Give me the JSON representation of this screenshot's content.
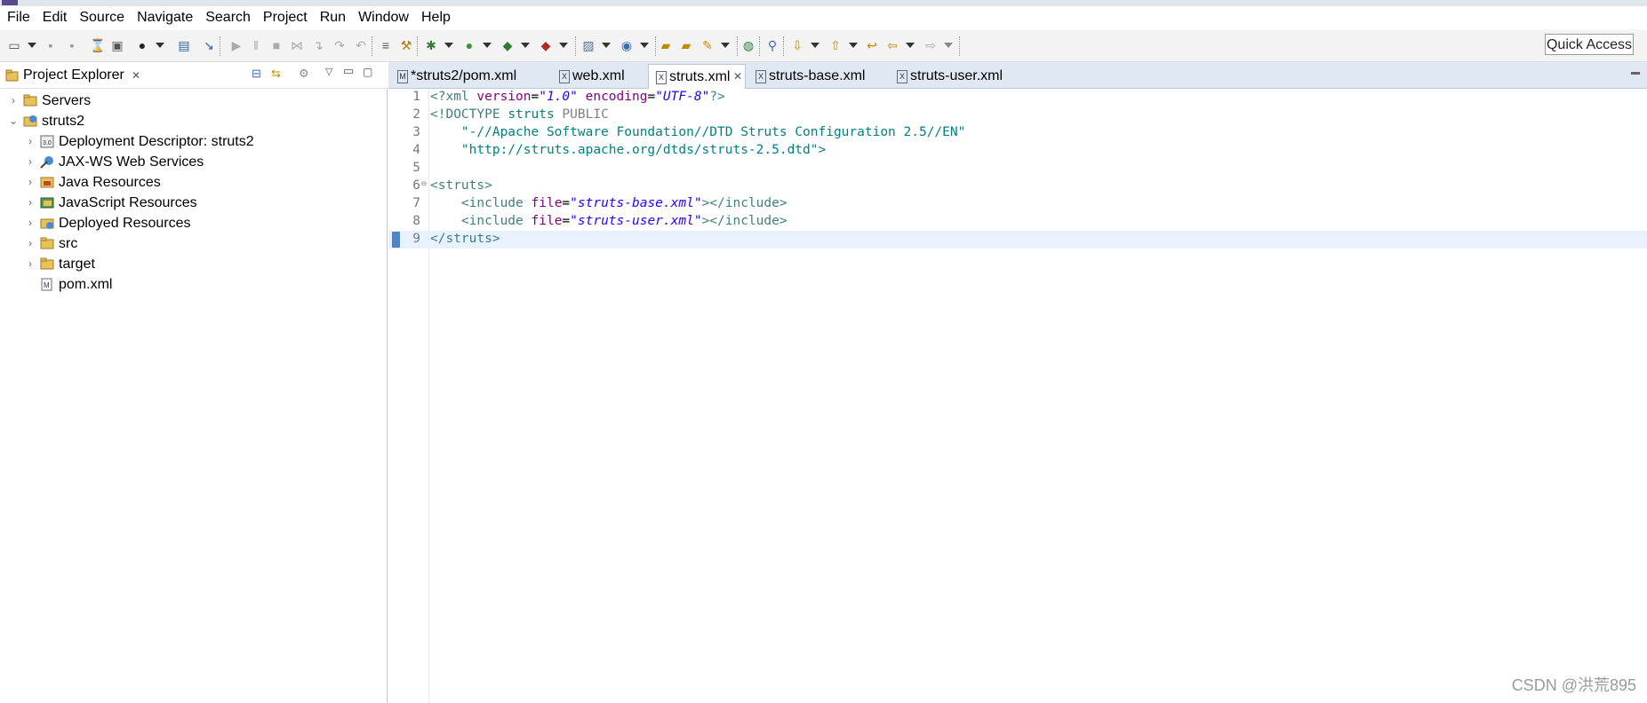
{
  "menu": [
    "File",
    "Edit",
    "Source",
    "Navigate",
    "Search",
    "Project",
    "Run",
    "Window",
    "Help"
  ],
  "toolbar": {
    "quick_access": "Quick Access"
  },
  "project_explorer": {
    "title": "Project Explorer",
    "tree": [
      {
        "label": "Servers",
        "level": 0,
        "expanded": false
      },
      {
        "label": "struts2",
        "level": 0,
        "expanded": true
      },
      {
        "label": "Deployment Descriptor: struts2",
        "level": 1,
        "expanded": false
      },
      {
        "label": "JAX-WS Web Services",
        "level": 1,
        "expanded": false
      },
      {
        "label": "Java Resources",
        "level": 1,
        "expanded": false
      },
      {
        "label": "JavaScript Resources",
        "level": 1,
        "expanded": false
      },
      {
        "label": "Deployed Resources",
        "level": 1,
        "expanded": false
      },
      {
        "label": "src",
        "level": 1,
        "expanded": false
      },
      {
        "label": "target",
        "level": 1,
        "expanded": false
      },
      {
        "label": "pom.xml",
        "level": 1,
        "leaf": true
      }
    ]
  },
  "editor": {
    "tabs": [
      {
        "label": "*struts2/pom.xml",
        "icon": "M"
      },
      {
        "label": "web.xml",
        "icon": "X"
      },
      {
        "label": "struts.xml",
        "icon": "X",
        "active": true
      },
      {
        "label": "struts-base.xml",
        "icon": "X"
      },
      {
        "label": "struts-user.xml",
        "icon": "X"
      }
    ],
    "line_numbers": [
      "1",
      "2",
      "3",
      "4",
      "5",
      "6",
      "7",
      "8",
      "9"
    ],
    "code": {
      "l1_a": "<?xml ",
      "l1_b": "version",
      "l1_c": "=",
      "l1_d": "\"1.0\"",
      "l1_e": " encoding",
      "l1_f": "=",
      "l1_g": "\"UTF-8\"",
      "l1_h": "?>",
      "l2_a": "<!DOCTYPE ",
      "l2_b": "struts ",
      "l2_c": "PUBLIC",
      "l3": "    \"-//Apache Software Foundation//DTD Struts Configuration 2.5//EN\"",
      "l4": "    \"http://struts.apache.org/dtds/struts-2.5.dtd\">",
      "l6": "<struts>",
      "l7_a": "    <include ",
      "l7_b": "file",
      "l7_c": "=",
      "l7_d": "\"struts-base.xml\"",
      "l7_e": "></include>",
      "l8_a": "    <include ",
      "l8_b": "file",
      "l8_c": "=",
      "l8_d": "\"struts-user.xml\"",
      "l8_e": "></include>",
      "l9": "</struts>"
    }
  },
  "watermark": "CSDN @洪荒895"
}
